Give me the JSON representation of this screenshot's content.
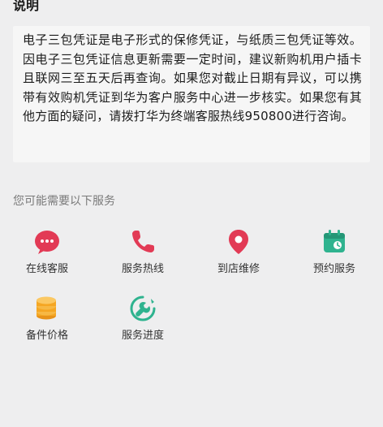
{
  "description": {
    "heading": "说明",
    "body": "电子三包凭证是电子形式的保修凭证，与纸质三包凭证等效。因电子三包凭证信息更新需要一定时间，建议新购机用户插卡且联网三至五天后再查询。如果您对截止日期有异议，可以携带有效购机凭证到华为客户服务中心进一步核实。如果您有其他方面的疑问，请拨打华为终端客服热线950800进行咨询。"
  },
  "services": {
    "heading": "您可能需要以下服务",
    "items": [
      {
        "label": "在线客服",
        "icon": "chat-bubble-icon",
        "color": "#e23a55"
      },
      {
        "label": "服务热线",
        "icon": "phone-icon",
        "color": "#e23a55"
      },
      {
        "label": "到店维修",
        "icon": "location-pin-icon",
        "color": "#e23a55"
      },
      {
        "label": "预约服务",
        "icon": "calendar-icon",
        "color": "#2fb38f"
      },
      {
        "label": "备件价格",
        "icon": "coin-stack-icon",
        "color": "#f5a623"
      },
      {
        "label": "服务进度",
        "icon": "wrench-progress-icon",
        "color": "#2fb38f"
      }
    ]
  }
}
